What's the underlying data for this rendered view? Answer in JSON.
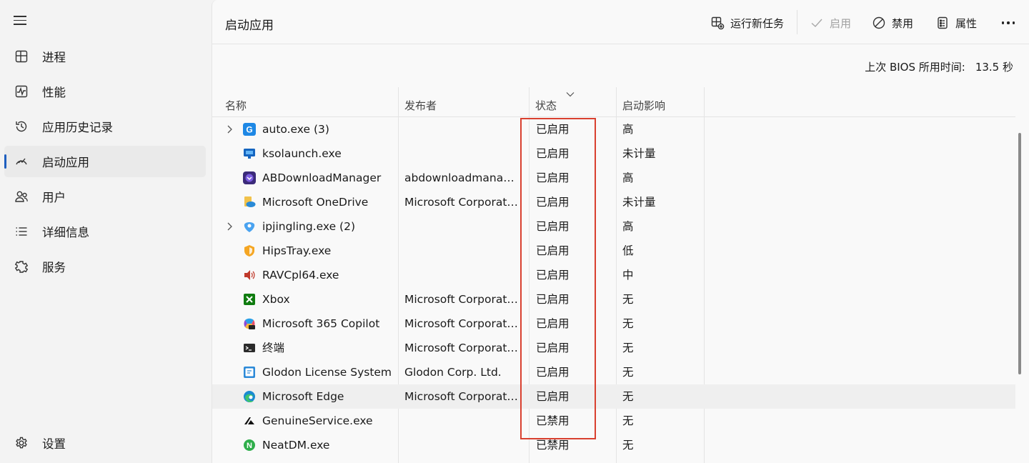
{
  "sidebar": {
    "menu_icon": "hamburger-icon",
    "items": [
      {
        "label": "进程",
        "icon": "processes-icon"
      },
      {
        "label": "性能",
        "icon": "performance-icon"
      },
      {
        "label": "应用历史记录",
        "icon": "history-icon"
      },
      {
        "label": "启动应用",
        "icon": "startup-icon",
        "active": true
      },
      {
        "label": "用户",
        "icon": "users-icon"
      },
      {
        "label": "详细信息",
        "icon": "details-icon"
      },
      {
        "label": "服务",
        "icon": "services-icon"
      }
    ],
    "settings_label": "设置"
  },
  "header": {
    "title": "启动应用",
    "run_new_task": "运行新任务",
    "enable": "启用",
    "disable": "禁用",
    "properties": "属性"
  },
  "bios": {
    "label": "上次 BIOS 所用时间:",
    "value": "13.5 秒"
  },
  "table": {
    "columns": {
      "name": "名称",
      "publisher": "发布者",
      "status": "状态",
      "impact": "启动影响"
    },
    "rows": [
      {
        "name": "auto.exe (3)",
        "publisher": "",
        "status": "已启用",
        "impact": "高",
        "expandable": true,
        "icon": "auto-icon"
      },
      {
        "name": "ksolaunch.exe",
        "publisher": "",
        "status": "已启用",
        "impact": "未计量",
        "expandable": false,
        "icon": "ksolaunch-icon"
      },
      {
        "name": "ABDownloadManager",
        "publisher": "abdownloadmanager...",
        "status": "已启用",
        "impact": "高",
        "expandable": false,
        "icon": "abdownload-icon"
      },
      {
        "name": "Microsoft OneDrive",
        "publisher": "Microsoft Corporation",
        "status": "已启用",
        "impact": "未计量",
        "expandable": false,
        "icon": "onedrive-icon"
      },
      {
        "name": "ipjingling.exe (2)",
        "publisher": "",
        "status": "已启用",
        "impact": "高",
        "expandable": true,
        "icon": "ipjingling-icon"
      },
      {
        "name": "HipsTray.exe",
        "publisher": "",
        "status": "已启用",
        "impact": "低",
        "expandable": false,
        "icon": "hipstray-icon"
      },
      {
        "name": "RAVCpl64.exe",
        "publisher": "",
        "status": "已启用",
        "impact": "中",
        "expandable": false,
        "icon": "speaker-icon"
      },
      {
        "name": "Xbox",
        "publisher": "Microsoft Corporation",
        "status": "已启用",
        "impact": "无",
        "expandable": false,
        "icon": "xbox-icon"
      },
      {
        "name": "Microsoft 365 Copilot",
        "publisher": "Microsoft Corporation",
        "status": "已启用",
        "impact": "无",
        "expandable": false,
        "icon": "copilot-icon"
      },
      {
        "name": "终端",
        "publisher": "Microsoft Corporation",
        "status": "已启用",
        "impact": "无",
        "expandable": false,
        "icon": "terminal-icon"
      },
      {
        "name": "Glodon License System",
        "publisher": "Glodon Corp. Ltd.",
        "status": "已启用",
        "impact": "无",
        "expandable": false,
        "icon": "glodon-icon"
      },
      {
        "name": "Microsoft Edge",
        "publisher": "Microsoft Corporation",
        "status": "已启用",
        "impact": "无",
        "expandable": false,
        "icon": "edge-icon",
        "highlighted": true
      },
      {
        "name": "GenuineService.exe",
        "publisher": "",
        "status": "已禁用",
        "impact": "无",
        "expandable": false,
        "icon": "genuine-icon"
      },
      {
        "name": "NeatDM.exe",
        "publisher": "",
        "status": "已禁用",
        "impact": "无",
        "expandable": false,
        "icon": "neatdm-icon"
      }
    ]
  },
  "colors": {
    "accent": "#1f5fbf",
    "annotation": "#d9402f"
  }
}
